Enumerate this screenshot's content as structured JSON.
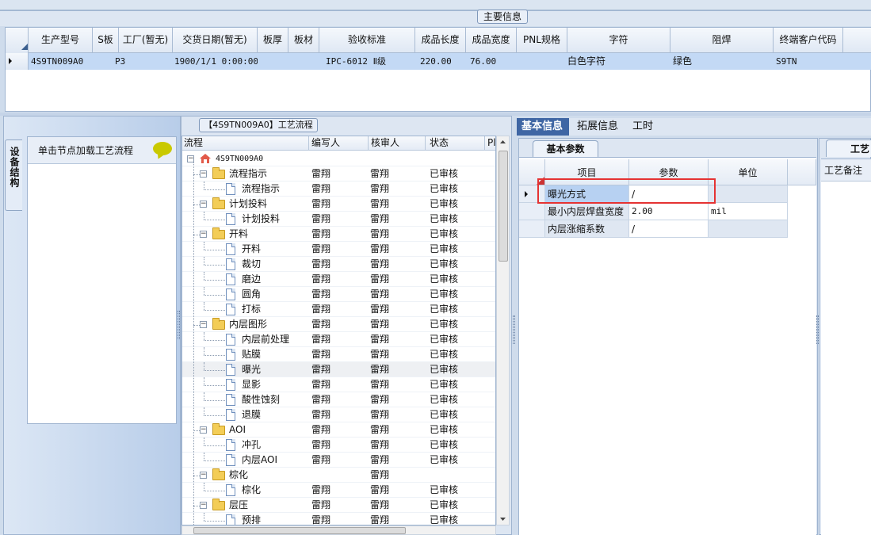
{
  "main_section": {
    "title": "主要信息"
  },
  "top_grid": {
    "headers": [
      "生产型号",
      "S板",
      "工厂(暂无)",
      "交货日期(暂无)",
      "板厚",
      "板材",
      "验收标准",
      "成品长度",
      "成品宽度",
      "PNL规格",
      "字符",
      "阻焊",
      "终端客户代码"
    ],
    "row": {
      "model": "4S9TN009A0",
      "s_board": "P3",
      "factory": "",
      "delivery_date": "1900/1/1 0:00:00",
      "thickness": "",
      "material": "",
      "standard": "IPC-6012 Ⅱ级",
      "length": "220.00",
      "width": "76.00",
      "pnl": "",
      "char": "白色字符",
      "solder_mask": "绿色",
      "customer_code": "S9TN"
    }
  },
  "left_panel": {
    "vertical_tab": "设备结构",
    "load_hint": "单击节点加载工艺流程"
  },
  "tree_panel": {
    "title": "【4S9TN009A0】工艺流程",
    "columns": [
      "流程",
      "编写人",
      "核审人",
      "状态",
      "Pl"
    ],
    "root": "4S9TN009A0",
    "rows": [
      {
        "name": "流程指示",
        "type": "folder",
        "writer": "雷翔",
        "reviewer": "雷翔",
        "status": "已审核"
      },
      {
        "name": "流程指示",
        "type": "doc",
        "writer": "雷翔",
        "reviewer": "雷翔",
        "status": "已审核"
      },
      {
        "name": "计划投料",
        "type": "folder",
        "writer": "雷翔",
        "reviewer": "雷翔",
        "status": "已审核"
      },
      {
        "name": "计划投料",
        "type": "doc",
        "writer": "雷翔",
        "reviewer": "雷翔",
        "status": "已审核"
      },
      {
        "name": "开料",
        "type": "folder",
        "writer": "雷翔",
        "reviewer": "雷翔",
        "status": "已审核"
      },
      {
        "name": "开料",
        "type": "doc",
        "writer": "雷翔",
        "reviewer": "雷翔",
        "status": "已审核"
      },
      {
        "name": "裁切",
        "type": "doc",
        "writer": "雷翔",
        "reviewer": "雷翔",
        "status": "已审核"
      },
      {
        "name": "磨边",
        "type": "doc",
        "writer": "雷翔",
        "reviewer": "雷翔",
        "status": "已审核"
      },
      {
        "name": "圆角",
        "type": "doc",
        "writer": "雷翔",
        "reviewer": "雷翔",
        "status": "已审核"
      },
      {
        "name": "打标",
        "type": "doc",
        "writer": "雷翔",
        "reviewer": "雷翔",
        "status": "已审核"
      },
      {
        "name": "内层图形",
        "type": "folder",
        "writer": "雷翔",
        "reviewer": "雷翔",
        "status": "已审核"
      },
      {
        "name": "内层前处理",
        "type": "doc",
        "writer": "雷翔",
        "reviewer": "雷翔",
        "status": "已审核"
      },
      {
        "name": "贴膜",
        "type": "doc",
        "writer": "雷翔",
        "reviewer": "雷翔",
        "status": "已审核"
      },
      {
        "name": "曝光",
        "type": "doc",
        "writer": "雷翔",
        "reviewer": "雷翔",
        "status": "已审核",
        "selected": true
      },
      {
        "name": "显影",
        "type": "doc",
        "writer": "雷翔",
        "reviewer": "雷翔",
        "status": "已审核"
      },
      {
        "name": "酸性蚀刻",
        "type": "doc",
        "writer": "雷翔",
        "reviewer": "雷翔",
        "status": "已审核"
      },
      {
        "name": "退膜",
        "type": "doc",
        "writer": "雷翔",
        "reviewer": "雷翔",
        "status": "已审核"
      },
      {
        "name": "AOI",
        "type": "folder",
        "writer": "雷翔",
        "reviewer": "雷翔",
        "status": "已审核"
      },
      {
        "name": "冲孔",
        "type": "doc",
        "writer": "雷翔",
        "reviewer": "雷翔",
        "status": "已审核"
      },
      {
        "name": "内层AOI",
        "type": "doc",
        "writer": "雷翔",
        "reviewer": "雷翔",
        "status": "已审核"
      },
      {
        "name": "棕化",
        "type": "folder",
        "writer": "",
        "reviewer": "雷翔",
        "status": ""
      },
      {
        "name": "棕化",
        "type": "doc",
        "writer": "雷翔",
        "reviewer": "雷翔",
        "status": "已审核"
      },
      {
        "name": "层压",
        "type": "folder",
        "writer": "雷翔",
        "reviewer": "雷翔",
        "status": "已审核"
      },
      {
        "name": "预排",
        "type": "doc",
        "writer": "雷翔",
        "reviewer": "雷翔",
        "status": "已审核"
      }
    ]
  },
  "right_tabs": [
    "基本信息",
    "拓展信息",
    "工时"
  ],
  "base_params": {
    "tab": "基本参数",
    "headers": [
      "项目",
      "参数",
      "单位"
    ],
    "rows": [
      {
        "item": "曝光方式",
        "param": "/",
        "unit": ""
      },
      {
        "item": "最小内层焊盘宽度",
        "param": "2.00",
        "unit": "mil"
      },
      {
        "item": "内层涨缩系数",
        "param": "/",
        "unit": ""
      }
    ]
  },
  "process_notes": {
    "tab": "工艺",
    "header": "工艺备注"
  }
}
